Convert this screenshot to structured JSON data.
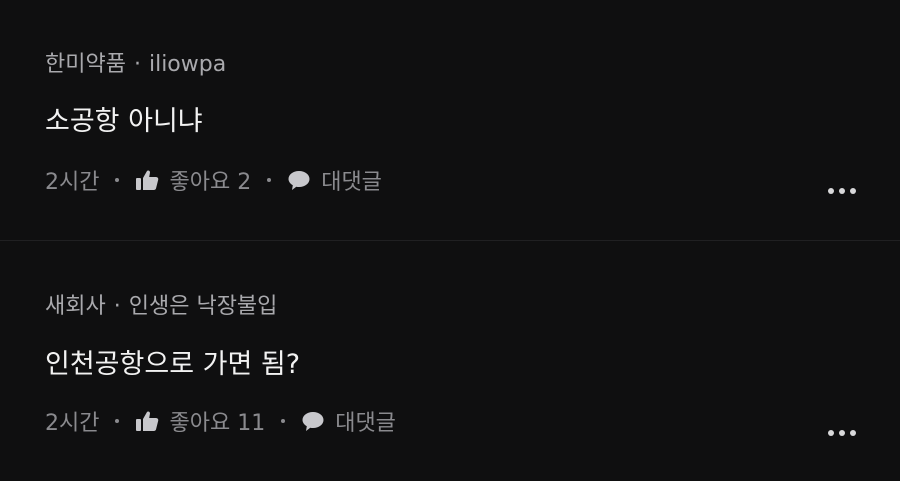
{
  "comments": [
    {
      "company": "한미약품",
      "separator": "·",
      "nickname": "iliowpa",
      "text": "소공항 아니냐",
      "time": "2시간",
      "like_label": "좋아요 2",
      "reply_label": "대댓글",
      "icons": {
        "like": "thumbs-up-icon",
        "reply": "speech-bubble-icon",
        "more": "more-dots-icon"
      }
    },
    {
      "company": "새회사",
      "separator": "·",
      "nickname": "인생은 낙장불입",
      "text": "인천공항으로 가면 됨?",
      "time": "2시간",
      "like_label": "좋아요 11",
      "reply_label": "대댓글",
      "icons": {
        "like": "thumbs-up-icon",
        "reply": "speech-bubble-icon",
        "more": "more-dots-icon"
      }
    }
  ],
  "colors": {
    "background": "#0f0f10",
    "primary_text": "#f2f2f2",
    "secondary_text": "#a9a9ad",
    "muted_text": "#8a8a8e",
    "divider": "#202022"
  }
}
